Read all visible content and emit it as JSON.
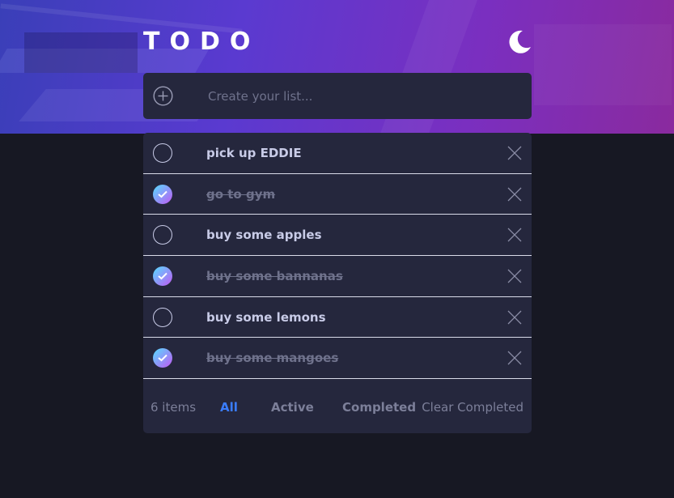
{
  "app": {
    "title": "TODO",
    "theme_icon": "moon-icon"
  },
  "new_todo": {
    "placeholder": "Create your list...",
    "value": "",
    "add_icon": "plus-circle-icon"
  },
  "todos": [
    {
      "text": "pick up EDDIE",
      "completed": false
    },
    {
      "text": "go to gym",
      "completed": true
    },
    {
      "text": "buy some apples",
      "completed": false
    },
    {
      "text": "buy some bannanas",
      "completed": true
    },
    {
      "text": "buy some lemons",
      "completed": false
    },
    {
      "text": "buy some mangoes",
      "completed": true
    }
  ],
  "footer": {
    "count": "6 items",
    "filters": {
      "all": "All",
      "active": "Active",
      "completed": "Completed"
    },
    "active_filter": "all",
    "clear_label": "Clear Completed"
  },
  "colors": {
    "accent": "#3a7cfd",
    "check_gradient_start": "#55ddff",
    "check_gradient_end": "#c058f3",
    "card_bg": "#25273d",
    "page_bg": "#171823"
  }
}
